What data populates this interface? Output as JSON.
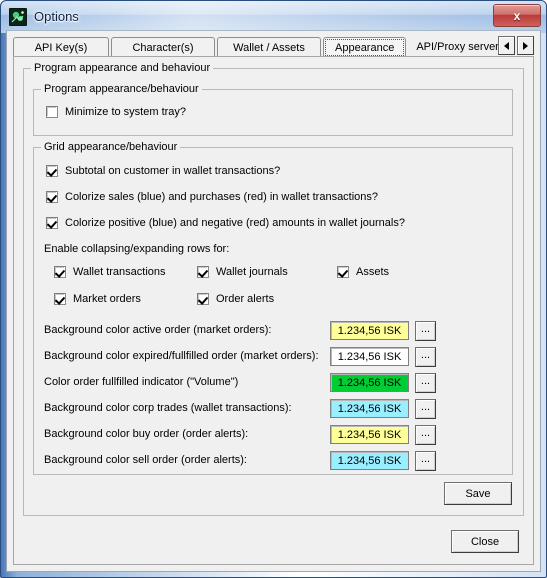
{
  "window": {
    "title": "Options",
    "app_icon": "eve-options-icon",
    "close_label": "x"
  },
  "tabs": {
    "items": [
      {
        "label": "API Key(s)",
        "selected": false
      },
      {
        "label": "Character(s)",
        "selected": false
      },
      {
        "label": "Wallet / Assets",
        "selected": false
      },
      {
        "label": "Appearance",
        "selected": true
      },
      {
        "label": "API/Proxy server",
        "selected": false
      }
    ],
    "scroll_left": "◄",
    "scroll_right": "►"
  },
  "groups": {
    "outer": {
      "legend": "Program appearance and behaviour"
    },
    "program": {
      "legend": "Program appearance/behaviour"
    },
    "grid": {
      "legend": "Grid appearance/behaviour"
    }
  },
  "program_options": [
    {
      "label": "Minimize to system tray?",
      "checked": false
    }
  ],
  "grid_options": [
    {
      "label": "Subtotal on customer in wallet transactions?",
      "checked": true
    },
    {
      "label": "Colorize sales (blue) and purchases (red) in wallet transactions?",
      "checked": true
    },
    {
      "label": "Colorize positive (blue) and negative (red) amounts in wallet journals?",
      "checked": true
    }
  ],
  "collapsing": {
    "heading": "Enable collapsing/expanding rows for:",
    "options": [
      {
        "label": "Wallet transactions",
        "checked": true
      },
      {
        "label": "Wallet journals",
        "checked": true
      },
      {
        "label": "Assets",
        "checked": true
      },
      {
        "label": "Market orders",
        "checked": true
      },
      {
        "label": "Order alerts",
        "checked": true
      }
    ]
  },
  "color_rows": [
    {
      "label": "Background color active order (market orders):",
      "sample": "1.234,56 ISK",
      "bg": "#FFFF99",
      "fg": "#000000",
      "browse": "..."
    },
    {
      "label": "Background color expired/fullfilled order (market orders):",
      "sample": "1.234,56 ISK",
      "bg": "#FFFFFF",
      "fg": "#000000",
      "browse": "..."
    },
    {
      "label": "Color order fullfilled indicator (\"Volume\")",
      "sample": "1.234,56 ISK",
      "bg": "#00CC33",
      "fg": "#000000",
      "browse": "..."
    },
    {
      "label": "Background color corp trades (wallet transactions):",
      "sample": "1.234,56 ISK",
      "bg": "#99EEFF",
      "fg": "#000000",
      "browse": "..."
    },
    {
      "label": "Background color buy order (order alerts):",
      "sample": "1.234,56 ISK",
      "bg": "#FFFF99",
      "fg": "#000000",
      "browse": "..."
    },
    {
      "label": "Background color sell order (order alerts):",
      "sample": "1.234,56 ISK",
      "bg": "#99EEFF",
      "fg": "#000000",
      "browse": "..."
    }
  ],
  "buttons": {
    "save": "Save",
    "close": "Close"
  },
  "colors": {
    "titlebar_accent": "#4a78b8",
    "close_button": "#b83b38",
    "dialog_face": "#f0f0f0"
  }
}
